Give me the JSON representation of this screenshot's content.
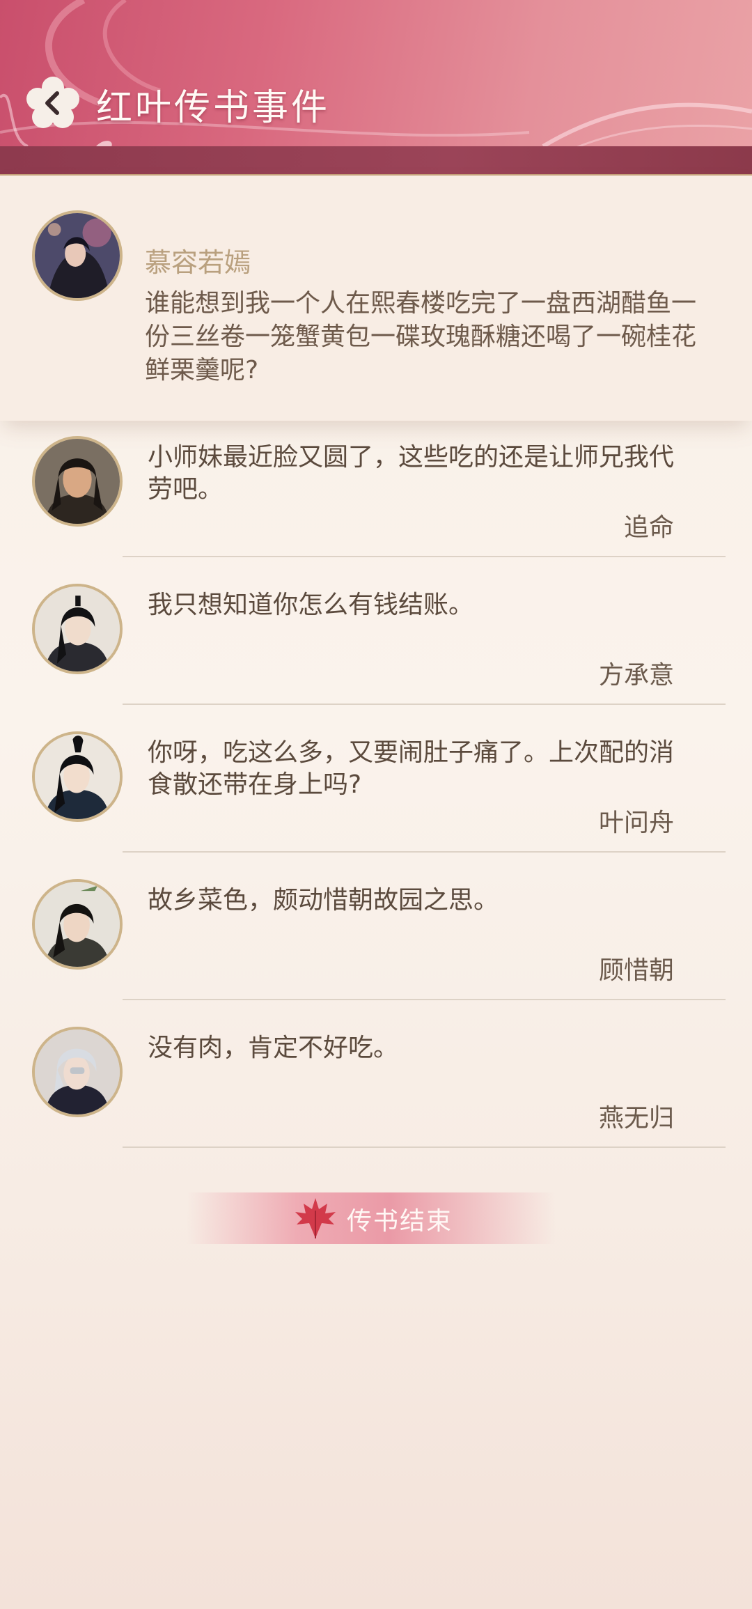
{
  "header": {
    "title": "红叶传书事件",
    "back_icon": "back-arrow-icon",
    "colors": {
      "primary": "#c94f6c",
      "band": "#8e3a4e"
    }
  },
  "post": {
    "author": "慕容若嫣",
    "text": "谁能想到我一个人在熙春楼吃完了一盘西湖醋鱼一份三丝卷一笼蟹黄包一碟玫瑰酥糖还喝了一碗桂花鲜栗羹呢?"
  },
  "replies": [
    {
      "text": "小师妹最近脸又圆了，这些吃的还是让师兄我代劳吧。",
      "author": "追命"
    },
    {
      "text": "我只想知道你怎么有钱结账。",
      "author": "方承意"
    },
    {
      "text": "你呀，吃这么多，又要闹肚子痛了。上次配的消食散还带在身上吗?",
      "author": "叶问舟"
    },
    {
      "text": "故乡菜色，颇动惜朝故园之思。",
      "author": "顾惜朝"
    },
    {
      "text": "没有肉，肯定不好吃。",
      "author": "燕无归"
    }
  ],
  "footer": {
    "end_label": "传书结束",
    "icon": "maple-leaf-icon"
  }
}
